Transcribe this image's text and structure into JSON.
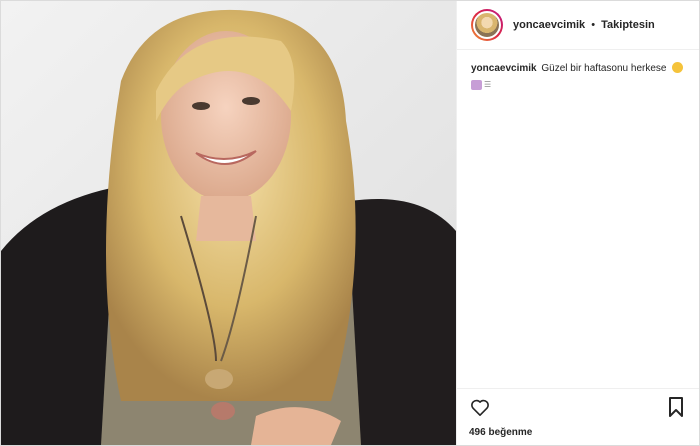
{
  "post": {
    "username": "yoncaevcimik",
    "separator": "•",
    "follow_status": "Takiptesin",
    "caption_user": "yoncaevcimik",
    "caption_text": "Güzel bir haftasonu herkese",
    "likes_text": "496 beğenme"
  },
  "icons": {
    "like": "heart-icon",
    "save": "bookmark-icon",
    "caption_emoji_1": "smiling-face-emoji",
    "caption_emoji_2": "house-emoji",
    "caption_emoji_3": "small-emoji"
  },
  "colors": {
    "border": "#dbdbdb",
    "text": "#262626",
    "avatar_ring_start": "#f09433",
    "avatar_ring_end": "#bc1888"
  }
}
